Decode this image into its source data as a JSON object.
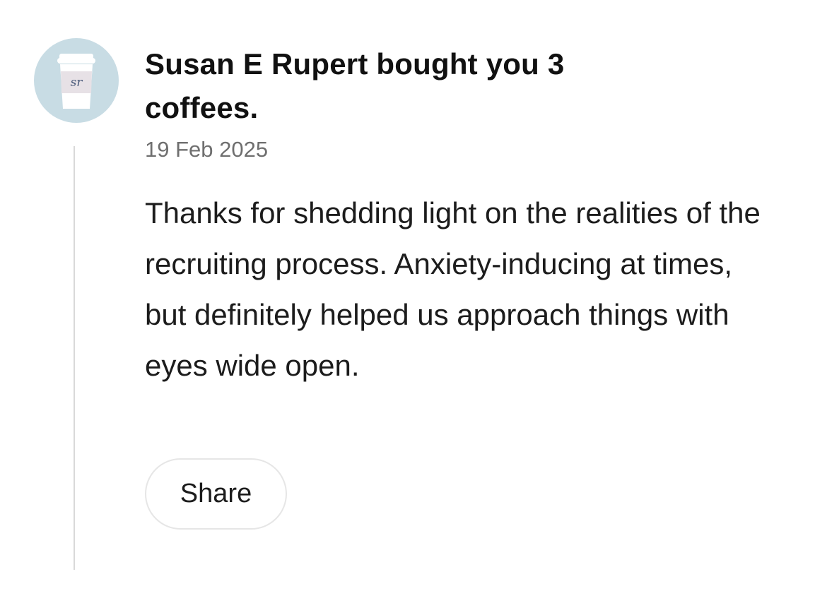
{
  "supporter": {
    "avatar_initials": "sr",
    "avatar_icon": "coffee-cup-icon",
    "avatar_background": "#c8dce4"
  },
  "post": {
    "title": "Susan E Rupert bought you 3 coffees.",
    "date": "19 Feb 2025",
    "message": "Thanks for shedding light on the realities of the recruiting process. Anxiety-inducing at times, but definitely helped us approach things with eyes wide open."
  },
  "actions": {
    "share_label": "Share"
  }
}
